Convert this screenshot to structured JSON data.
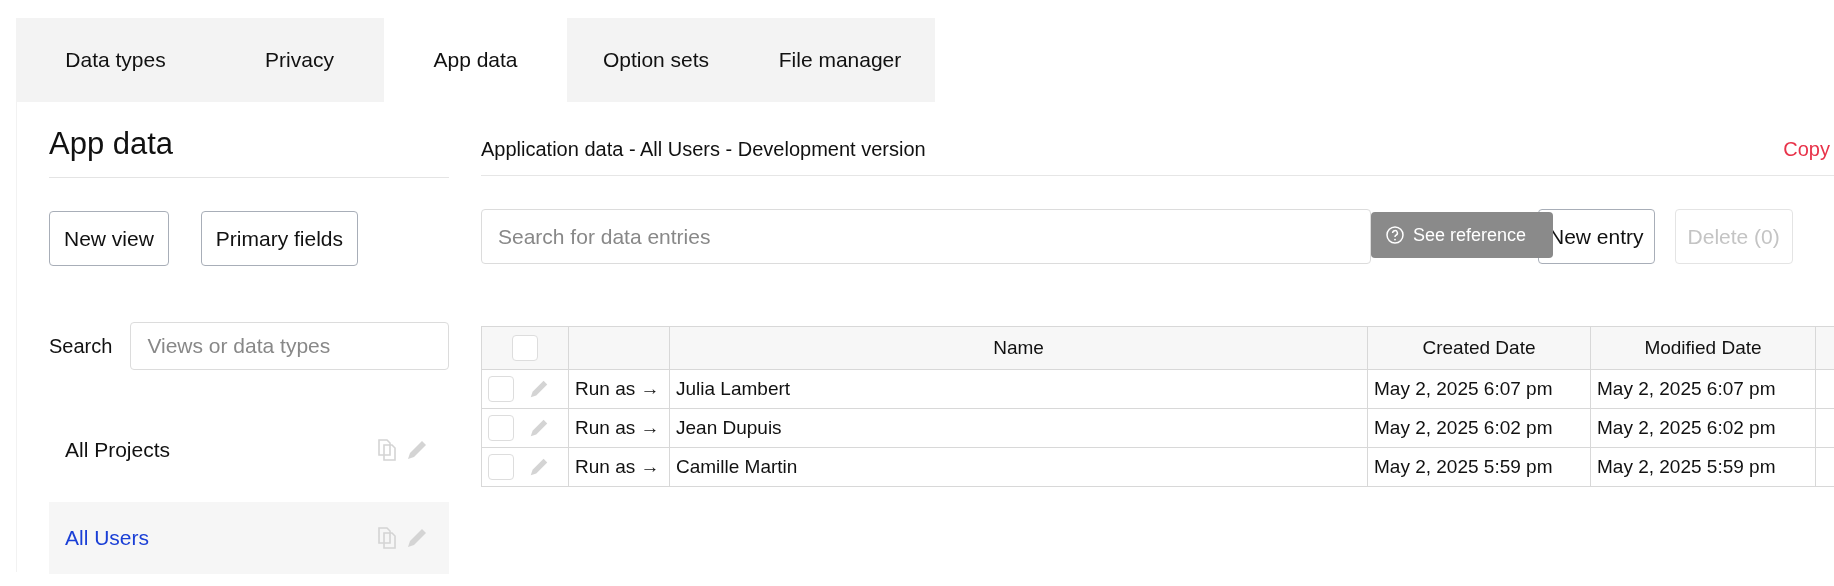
{
  "tabs": [
    {
      "label": "Data types",
      "selected": false
    },
    {
      "label": "Privacy",
      "selected": false
    },
    {
      "label": "App data",
      "selected": true
    },
    {
      "label": "Option sets",
      "selected": false
    },
    {
      "label": "File manager",
      "selected": false
    }
  ],
  "sidebar": {
    "title": "App data",
    "buttons": [
      "New view",
      "Primary fields"
    ],
    "search": {
      "label": "Search",
      "placeholder": "Views or data types"
    },
    "items": [
      {
        "label": "All Projects",
        "selected": false
      },
      {
        "label": "All Users",
        "selected": true
      }
    ]
  },
  "main": {
    "title": "Application data - All Users - Development version",
    "copy_link": "Copy",
    "search": {
      "placeholder": "Search for data entries"
    },
    "tooltip": "See reference",
    "buttons": [
      {
        "label": "New entry",
        "disabled": false
      },
      {
        "label": "Delete (0)",
        "disabled": true
      }
    ],
    "table": {
      "columns": [
        "Name",
        "Created Date",
        "Modified Date"
      ],
      "header_checked": false,
      "rows": [
        {
          "checked": false,
          "action": "Run as →",
          "name": "Julia Lambert",
          "created": "May 2, 2025 6:07 pm",
          "modified": "May 2, 2025 6:07 pm"
        },
        {
          "checked": false,
          "action": "Run as →",
          "name": "Jean Dupuis",
          "created": "May 2, 2025 6:02 pm",
          "modified": "May 2, 2025 6:02 pm"
        },
        {
          "checked": false,
          "action": "Run as →",
          "name": "Camille Martin",
          "created": "May 2, 2025 5:59 pm",
          "modified": "May 2, 2025 5:59 pm"
        }
      ]
    }
  }
}
